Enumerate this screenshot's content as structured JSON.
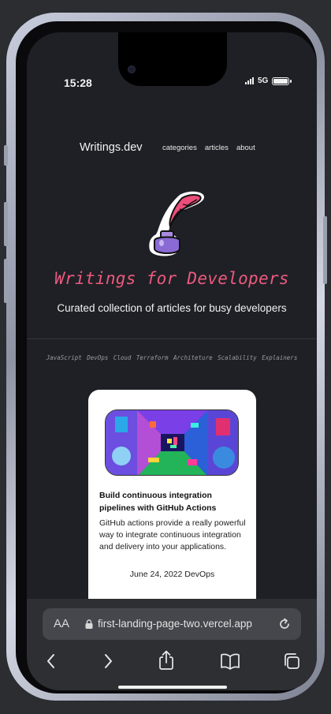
{
  "status": {
    "time": "15:28",
    "network": "5G"
  },
  "nav": {
    "logo": "Writings.dev",
    "links": [
      "categories",
      "articles",
      "about"
    ]
  },
  "hero": {
    "title": "Writings for Developers",
    "subtitle": "Curated collection of articles for busy developers",
    "icon": "quill-inkwell-icon"
  },
  "tags": [
    "JavaScript",
    "DevOps",
    "Cloud",
    "Terraform",
    "Architeture",
    "Scalability",
    "Explainers"
  ],
  "article": {
    "title": "Build continuous integration pipelines with GitHub Actions",
    "description": "GitHub actions provide a really powerful way to integrate continuous integration and delivery into your applications.",
    "meta": "June 24, 2022 DevOps"
  },
  "browser": {
    "text_size_label": "AA",
    "url": "first-landing-page-two.vercel.app"
  },
  "colors": {
    "accent": "#ec5a7e",
    "background": "#1f2025",
    "card": "#ffffff"
  }
}
